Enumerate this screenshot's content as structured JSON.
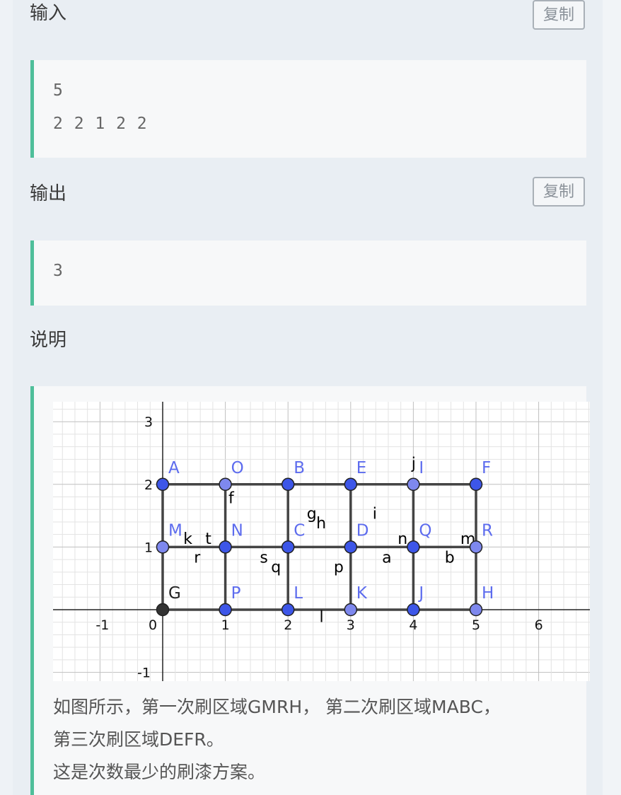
{
  "sample": {
    "input_title": "输入",
    "input_copy": "复制",
    "input_lines": [
      "5",
      "2 2 1 2 2"
    ],
    "output_title": "输出",
    "output_copy": "复制",
    "output_lines": [
      "3"
    ]
  },
  "explanation": {
    "title": "说明",
    "lines": [
      "如图所示，第一次刷区域GMRH， 第二次刷区域MABC，",
      "第三次刷区域DEFR。",
      "这是次数最少的刷漆方案。"
    ]
  },
  "figure": {
    "x_ticks": [
      "-1",
      "0",
      "1",
      "2",
      "3",
      "4",
      "5",
      "6"
    ],
    "y_ticks": [
      "3",
      "2",
      "1",
      "-1"
    ],
    "points": [
      {
        "label": "A",
        "x": 0,
        "y": 2
      },
      {
        "label": "O",
        "x": 1,
        "y": 2
      },
      {
        "label": "B",
        "x": 2,
        "y": 2
      },
      {
        "label": "E",
        "x": 3,
        "y": 2
      },
      {
        "label": "I",
        "x": 4,
        "y": 2
      },
      {
        "label": "F",
        "x": 5,
        "y": 2
      },
      {
        "label": "M",
        "x": 0,
        "y": 1
      },
      {
        "label": "N",
        "x": 1,
        "y": 1
      },
      {
        "label": "C",
        "x": 2,
        "y": 1
      },
      {
        "label": "D",
        "x": 3,
        "y": 1
      },
      {
        "label": "Q",
        "x": 4,
        "y": 1
      },
      {
        "label": "R",
        "x": 5,
        "y": 1
      },
      {
        "label": "G",
        "x": 0,
        "y": 0
      },
      {
        "label": "P",
        "x": 1,
        "y": 0
      },
      {
        "label": "L",
        "x": 2,
        "y": 0
      },
      {
        "label": "K",
        "x": 3,
        "y": 0
      },
      {
        "label": "J",
        "x": 4,
        "y": 0
      },
      {
        "label": "H",
        "x": 5,
        "y": 0
      }
    ],
    "segment_labels": [
      {
        "label": "f",
        "x": 1.05,
        "y": 1.7
      },
      {
        "label": "g",
        "x": 2.3,
        "y": 1.45
      },
      {
        "label": "h",
        "x": 2.45,
        "y": 1.3
      },
      {
        "label": "i",
        "x": 3.35,
        "y": 1.45
      },
      {
        "label": "j",
        "x": 3.97,
        "y": 2.25
      },
      {
        "label": "k",
        "x": 0.33,
        "y": 1.05
      },
      {
        "label": "t",
        "x": 0.68,
        "y": 1.05
      },
      {
        "label": "r",
        "x": 0.5,
        "y": 0.75
      },
      {
        "label": "s",
        "x": 1.55,
        "y": 0.75
      },
      {
        "label": "q",
        "x": 1.73,
        "y": 0.6
      },
      {
        "label": "p",
        "x": 2.73,
        "y": 0.6
      },
      {
        "label": "a",
        "x": 3.5,
        "y": 0.75
      },
      {
        "label": "b",
        "x": 4.5,
        "y": 0.75
      },
      {
        "label": "n",
        "x": 3.75,
        "y": 1.05
      },
      {
        "label": "m",
        "x": 4.75,
        "y": 1.05
      },
      {
        "label": "l",
        "x": 2.5,
        "y": -0.2
      }
    ]
  },
  "colors": {
    "point_dark": "#3d56e8",
    "point_light": "#7e88ee",
    "point_origin": "#333333",
    "label_blue": "#5d6cee",
    "accent_green": "#4fbf9a"
  }
}
